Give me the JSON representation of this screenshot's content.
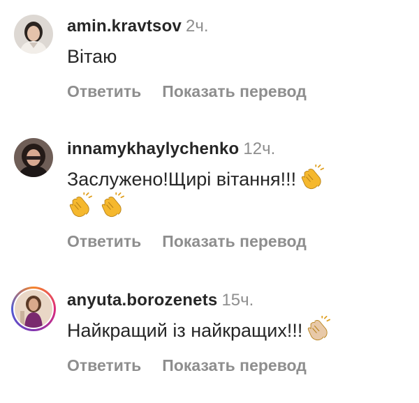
{
  "comments": [
    {
      "username": "amin.kravtsov",
      "time": "2ч.",
      "text": "Вітаю",
      "emojis": [],
      "reply_label": "Ответить",
      "translate_label": "Показать перевод"
    },
    {
      "username": "innamykhaylychenko",
      "time": "12ч.",
      "text": "Заслужено!Щирі вітання!!!",
      "emojis": [
        "clapping-hands-icon",
        "clapping-hands-icon",
        "clapping-hands-icon"
      ],
      "reply_label": "Ответить",
      "translate_label": "Показать перевод"
    },
    {
      "username": "anyuta.borozenets",
      "time": "15ч.",
      "text": "Найкращий із найкращих!!!",
      "emojis": [
        "clapping-hands-light-skin-icon"
      ],
      "reply_label": "Ответить",
      "translate_label": "Показать перевод"
    }
  ],
  "colors": {
    "primary_text": "#262626",
    "secondary_text": "#8e8e8e",
    "emoji_yellow": "#f5b82e",
    "emoji_light_skin": "#e8c9a8"
  }
}
